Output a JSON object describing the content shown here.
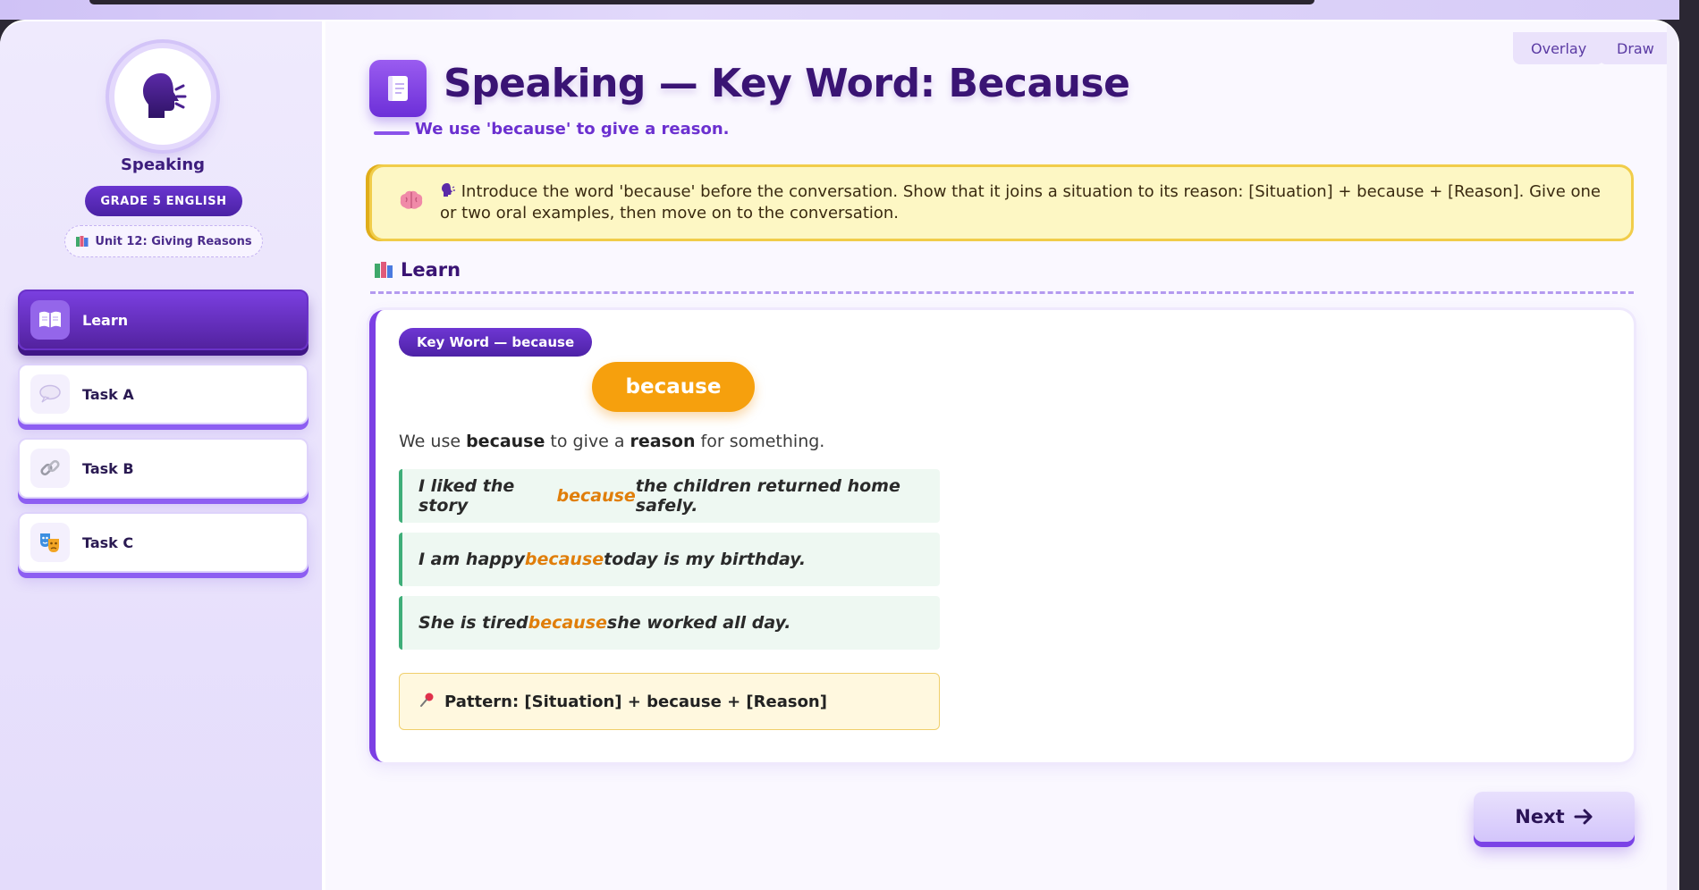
{
  "toolbar": {
    "overlay_label": "Overlay",
    "draw_label": "Draw"
  },
  "sidebar": {
    "title": "Speaking",
    "grade_badge": "GRADE 5 ENGLISH",
    "unit_badge": "Unit 12: Giving Reasons",
    "unit_icon": "books-icon",
    "items": [
      {
        "label": "Learn",
        "icon": "open-book-icon",
        "active": true
      },
      {
        "label": "Task A",
        "icon": "speech-bubble-icon",
        "active": false
      },
      {
        "label": "Task B",
        "icon": "chain-link-icon",
        "active": false
      },
      {
        "label": "Task C",
        "icon": "theatre-masks-icon",
        "active": false
      }
    ]
  },
  "main": {
    "title": "Speaking — Key Word: Because",
    "subtitle": "We use 'because' to give a reason.",
    "teacher_note": "Introduce the word 'because' before the conversation. Show that it joins a situation to its reason: [Situation] + because + [Reason]. Give one or two oral examples, then move on to the conversation.",
    "section_heading": "Learn",
    "card": {
      "pill_label": "Key Word — because",
      "word": "because",
      "rule": {
        "before": "We use ",
        "key1": "because",
        "middle": " to give a ",
        "key2": "reason",
        "after": " for something."
      },
      "examples": [
        {
          "before": "I liked the story ",
          "keyword": "because",
          "after": " the children returned home safely."
        },
        {
          "before": "I am happy ",
          "keyword": "because",
          "after": " today is my birthday."
        },
        {
          "before": "She is tired ",
          "keyword": "because",
          "after": " she worked all day."
        }
      ],
      "pattern": "Pattern: [Situation] + because + [Reason]"
    },
    "next_label": "Next"
  },
  "colors": {
    "accent": "#6c2fd8",
    "highlight": "#e07e0a",
    "word_pill": "#f6a00d",
    "note_bg": "#fdf7c4",
    "example_bg": "#eef8f2"
  }
}
